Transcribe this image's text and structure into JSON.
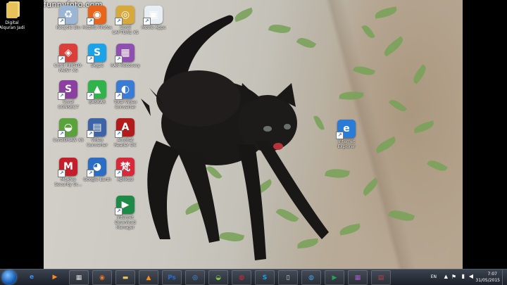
{
  "watermark": "funnyfoto.com",
  "left_icon": {
    "label": "Digital Alquran Jadi",
    "icon": "folder-icon"
  },
  "desktop_icons": [
    {
      "label": "Recycle Bin",
      "icon": "recycle-bin-icon",
      "color": "#9bb6d4",
      "glyph": "♻"
    },
    {
      "label": "Mozilla Firefox",
      "icon": "firefox-icon",
      "color": "#e8641c",
      "glyph": "◉"
    },
    {
      "label": "Corel CAPTURE X5",
      "icon": "corel-capture-icon",
      "color": "#d7a93a",
      "glyph": "◎"
    },
    {
      "label": "Movie Apps",
      "icon": "movie-apps-icon",
      "color": "#e7eef4",
      "glyph": "▣"
    },
    {
      "label": "Corel PHOTO-PAINT X5",
      "icon": "corel-photopaint-icon",
      "color": "#d9403a",
      "glyph": "◈"
    },
    {
      "label": "Skype",
      "icon": "skype-icon",
      "color": "#1aa3e8",
      "glyph": "S"
    },
    {
      "label": "RAR Recovery",
      "icon": "rar-recovery-icon",
      "color": "#8e4fb0",
      "glyph": "▦"
    },
    {
      "label": "Corel CONNECT",
      "icon": "corel-connect-icon",
      "color": "#8b3fa0",
      "glyph": "S"
    },
    {
      "label": "BASKAR",
      "icon": "basketball-icon",
      "color": "#2fb34a",
      "glyph": "▲"
    },
    {
      "label": "Total Video Converter",
      "icon": "video-converter-icon",
      "color": "#3a7bd5",
      "glyph": "◐"
    },
    {
      "label": "CorelDRAW X5",
      "icon": "coreldraw-icon",
      "color": "#5aa33c",
      "glyph": "◒"
    },
    {
      "label": "Video Converter",
      "icon": "film-converter-icon",
      "color": "#3d64a8",
      "glyph": "▤"
    },
    {
      "label": "Acrobat Reader DC",
      "icon": "acrobat-reader-icon",
      "color": "#b31b1b",
      "glyph": "A"
    },
    {
      "label": "McAfee Security Sc...",
      "icon": "mcafee-icon",
      "color": "#c41e2a",
      "glyph": "M"
    },
    {
      "label": "Google Earth",
      "icon": "google-earth-icon",
      "color": "#2b6cc4",
      "glyph": "◕"
    },
    {
      "label": "Aplikasi",
      "icon": "app-icon",
      "color": "#d8283a",
      "glyph": "梵"
    },
    {
      "label": "Internet Download Manager",
      "icon": "idm-icon",
      "color": "#1e8a48",
      "glyph": "▶"
    },
    {
      "label": "Internet Explorer",
      "icon": "internet-explorer-icon",
      "color": "#2a7ad8",
      "glyph": "e"
    }
  ],
  "taskbar": {
    "items": [
      {
        "icon": "internet-explorer-icon",
        "glyph": "e",
        "color": "#3b8df0"
      },
      {
        "icon": "media-player-icon",
        "glyph": "▶",
        "color": "#ff8a1c"
      },
      {
        "icon": "calendar-icon",
        "glyph": "▦",
        "color": "#d9d9d9"
      },
      {
        "icon": "firefox-icon",
        "glyph": "◉",
        "color": "#f07620"
      },
      {
        "icon": "folder-icon",
        "glyph": "▬",
        "color": "#e8c25a"
      },
      {
        "icon": "vlc-icon",
        "glyph": "▲",
        "color": "#f28c1a"
      },
      {
        "icon": "photoshop-icon",
        "glyph": "Ps",
        "color": "#2a6bd3"
      },
      {
        "icon": "chrome-icon",
        "glyph": "◎",
        "color": "#4b9af0"
      },
      {
        "icon": "coreldraw-icon",
        "glyph": "◒",
        "color": "#7bc043"
      },
      {
        "icon": "app-icon",
        "glyph": "◍",
        "color": "#d8283a"
      },
      {
        "icon": "skype-icon",
        "glyph": "S",
        "color": "#1aa3e8"
      },
      {
        "icon": "phone-icon",
        "glyph": "▯",
        "color": "#cfd8e3"
      },
      {
        "icon": "network-globe-icon",
        "glyph": "◍",
        "color": "#4aa0e0"
      },
      {
        "icon": "idm-icon",
        "glyph": "▶",
        "color": "#23a455"
      },
      {
        "icon": "rar-icon",
        "glyph": "▦",
        "color": "#a45cc4"
      },
      {
        "icon": "winrar-icon",
        "glyph": "▤",
        "color": "#b24444"
      }
    ],
    "language": "EN",
    "time": "7:07",
    "date": "31/05/2015"
  }
}
